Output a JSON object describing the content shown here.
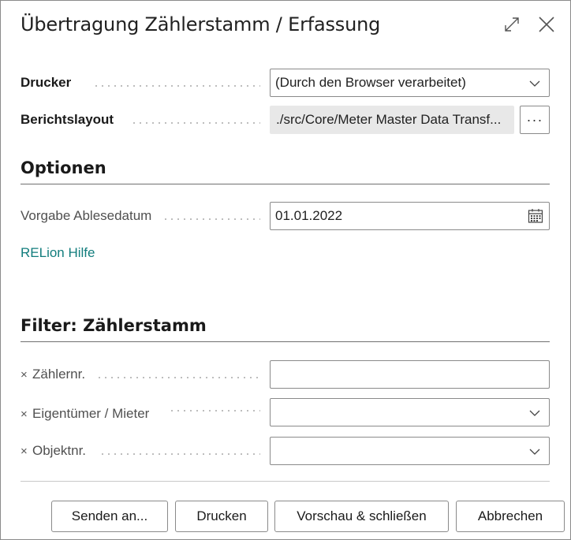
{
  "dialog": {
    "title": "Übertragung Zählerstamm / Erfassung"
  },
  "printer": {
    "label": "Drucker",
    "value": "(Durch den Browser verarbeitet)"
  },
  "report_layout": {
    "label": "Berichtslayout",
    "value": "./src/Core/Meter Master Data Transf...",
    "more_label": "···"
  },
  "options": {
    "heading": "Optionen",
    "reading_date": {
      "label": "Vorgabe Ablesedatum",
      "value": "01.01.2022"
    },
    "help_link": "RELion Hilfe"
  },
  "filter": {
    "heading": "Filter: Zählerstamm",
    "fields": [
      {
        "label": "Zählernr.",
        "value": ""
      },
      {
        "label": "Eigentümer / Mieter",
        "value": ""
      },
      {
        "label": "Objektnr.",
        "value": ""
      }
    ]
  },
  "footer": {
    "send_label": "Senden an...",
    "print_label": "Drucken",
    "preview_label": "Vorschau & schließen",
    "cancel_label": "Abbrechen"
  },
  "icons": {
    "expand": "expand-icon",
    "close": "close-icon",
    "chevron": "chevron-down-icon",
    "calendar": "calendar-icon",
    "remove_filter": "remove-filter-icon"
  }
}
